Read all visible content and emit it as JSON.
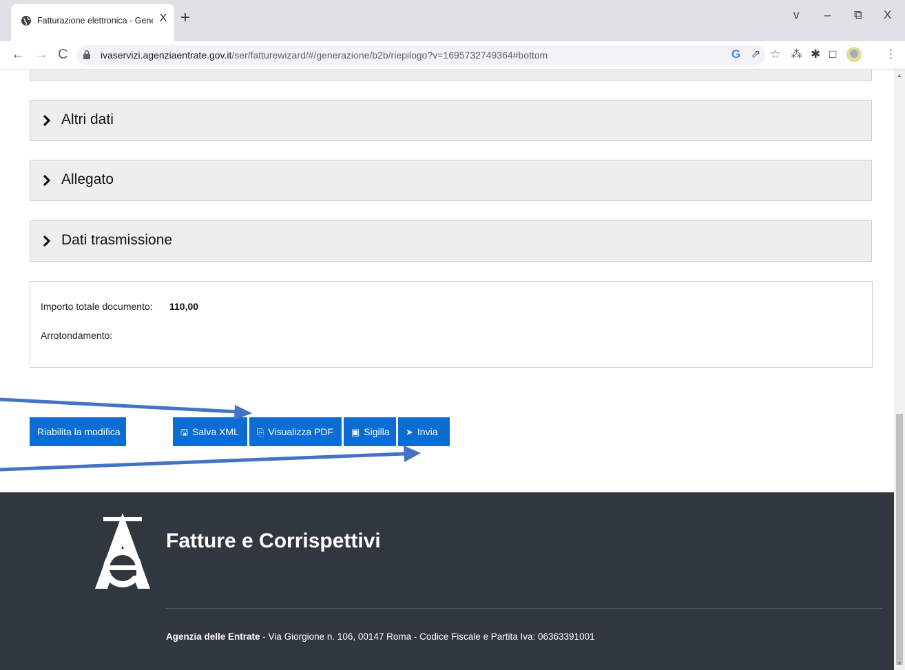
{
  "browser": {
    "tab_title": "Fatturazione elettronica - Genera",
    "tab_close": "X",
    "new_tab": "+",
    "window_controls": [
      "v",
      "–",
      "⧉",
      "X"
    ],
    "url_host": "ivaservizi.agenziaentrate.gov.it",
    "url_path": "/ser/fatturewizard/#/generazione/b2b/riepilogo?v=1695732749364#bottom",
    "toolbar_icons": [
      "google-icon",
      "share-icon",
      "star-icon",
      "extensions-grid-icon",
      "puzzle-icon",
      "sidepanel-icon",
      "profile-avatar",
      "menu-icon"
    ]
  },
  "sections": [
    {
      "label": "Altri dati"
    },
    {
      "label": "Allegato"
    },
    {
      "label": "Dati trasmissione"
    }
  ],
  "totals": {
    "importo_label": "Importo totale documento:",
    "importo_value": "110,00",
    "arrotondamento_label": "Arrotondamento:"
  },
  "actions": {
    "riabilita": "Riabilita la modifica",
    "salva_xml": "Salva XML",
    "visualizza_pdf": "Visualizza PDF",
    "sigilla": "Sigilla",
    "invia": "Invia"
  },
  "footer": {
    "brand": "Fatture e Corrispettivi",
    "agency": "Agenzia delle Entrate",
    "address": " - Via Giorgione n. 106, 00147 Roma - Codice Fiscale e Partita Iva: 06363391001"
  },
  "colors": {
    "button_blue": "#0b6cd1",
    "footer_bg": "#30373e",
    "accordion_bg": "#eeeeee",
    "annotation_arrow": "#4472c4"
  }
}
